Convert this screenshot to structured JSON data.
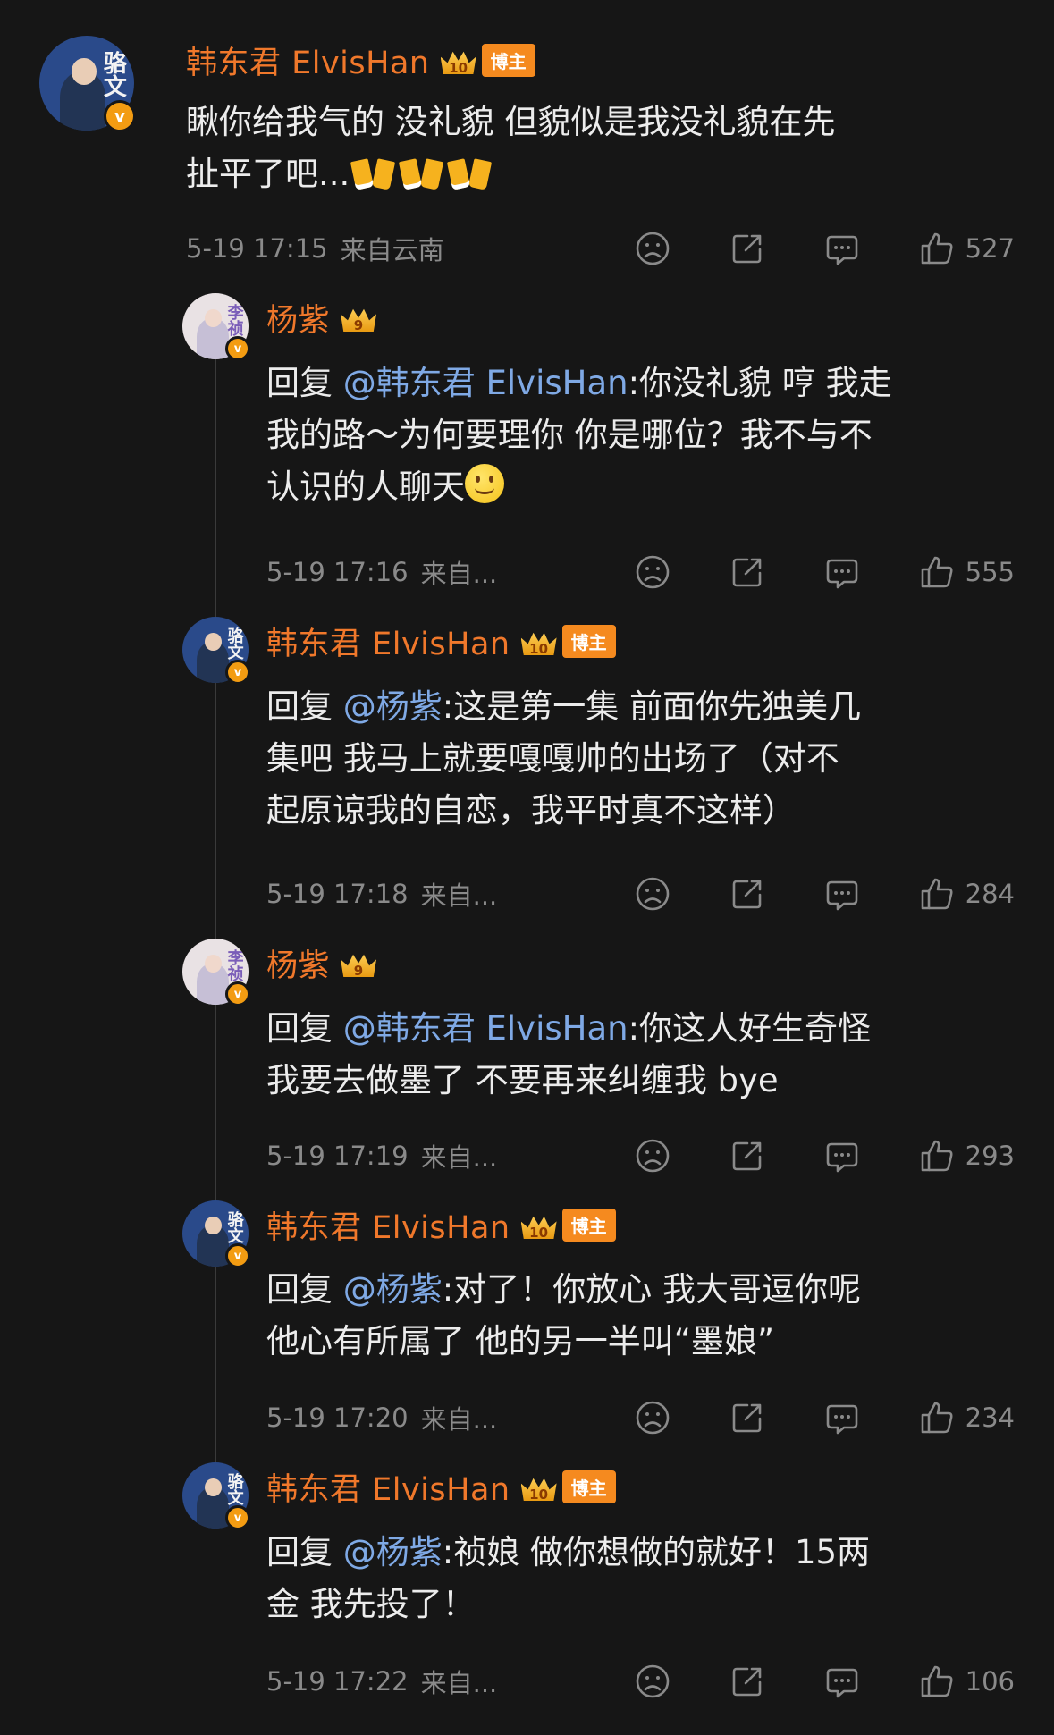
{
  "comments": [
    {
      "id": "c1",
      "username": "韩东君 ElvisHan",
      "crown_level": "10",
      "tag": "博主",
      "avatar_text": "骆文",
      "text_lines": [
        "瞅你给我气的  没礼貌   但貌似是我没礼貌在先",
        "扯平了吧..."
      ],
      "time": "5-19 17:15",
      "location": "来自云南",
      "likes": "527"
    },
    {
      "id": "c2",
      "username": "杨紫",
      "crown_level": "9",
      "avatar_text": "李祯",
      "reply_prefix": "回复 ",
      "mention": "@韩东君 ElvisHan",
      "text_lines": [
        ":你没礼貌  哼  我走",
        "我的路～为何要理你  你是哪位？我不与不",
        "认识的人聊天"
      ],
      "time": "5-19 17:16",
      "location": "来自...",
      "likes": "555"
    },
    {
      "id": "c3",
      "username": "韩东君 ElvisHan",
      "crown_level": "10",
      "tag": "博主",
      "avatar_text": "骆文",
      "reply_prefix": "回复 ",
      "mention": "@杨紫",
      "text_lines": [
        ":这是第一集  前面你先独美几",
        "集吧   我马上就要嘎嘎帅的出场了（对不",
        "起原谅我的自恋，我平时真不这样）"
      ],
      "time": "5-19 17:18",
      "location": "来自...",
      "likes": "284"
    },
    {
      "id": "c4",
      "username": "杨紫",
      "crown_level": "9",
      "avatar_text": "李祯",
      "reply_prefix": "回复 ",
      "mention": "@韩东君 ElvisHan",
      "text_lines": [
        ":你这人好生奇怪",
        "我要去做墨了  不要再来纠缠我  bye"
      ],
      "time": "5-19 17:19",
      "location": "来自...",
      "likes": "293"
    },
    {
      "id": "c5",
      "username": "韩东君 ElvisHan",
      "crown_level": "10",
      "tag": "博主",
      "avatar_text": "骆文",
      "reply_prefix": "回复 ",
      "mention": "@杨紫",
      "text_lines": [
        ":对了！你放心  我大哥逗你呢",
        "他心有所属了   他的另一半叫“墨娘”"
      ],
      "time": "5-19 17:20",
      "location": "来自...",
      "likes": "234"
    },
    {
      "id": "c6",
      "username": "韩东君 ElvisHan",
      "crown_level": "10",
      "tag": "博主",
      "avatar_text": "骆文",
      "reply_prefix": "回复 ",
      "mention": "@杨紫",
      "text_lines": [
        ":祯娘   做你想做的就好！15两",
        "金  我先投了！"
      ],
      "time": "5-19 17:22",
      "location": "来自...",
      "likes": "106"
    }
  ],
  "icons": {
    "dislike": "frown-face-icon",
    "share": "share-icon",
    "comment": "comment-icon",
    "like": "thumbs-up-icon",
    "verified": "verified-v-icon",
    "crown": "crown-icon"
  },
  "colors": {
    "background": "#161616",
    "username": "#f0782b",
    "mention": "#7fa9e5",
    "meta": "#8a8a8a",
    "blogger_tag": "#f58a1f"
  }
}
